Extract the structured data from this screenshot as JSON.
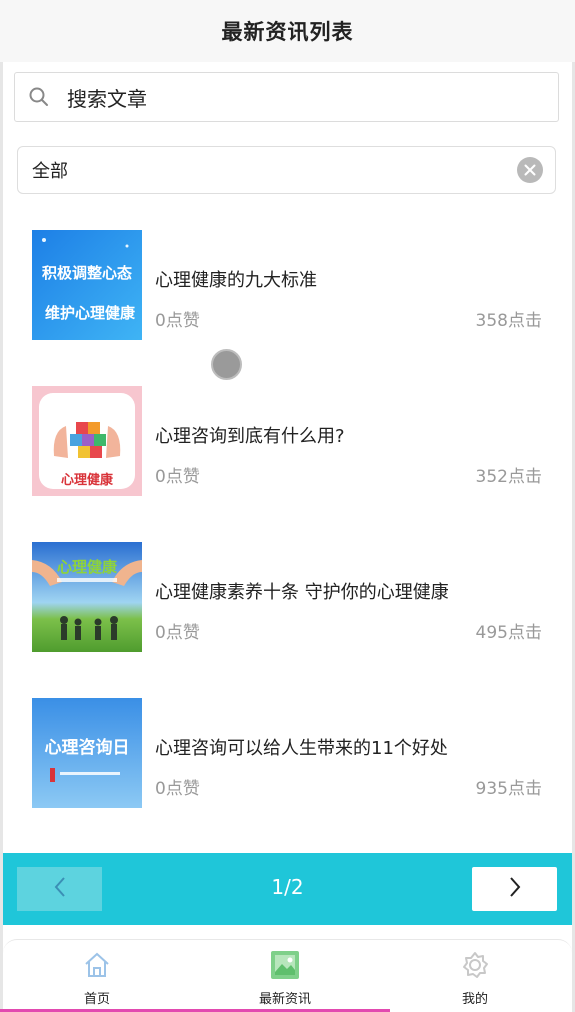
{
  "header": {
    "title": "最新资讯列表"
  },
  "search": {
    "placeholder": "搜索文章",
    "icon": "search-icon"
  },
  "filter": {
    "value": "全部",
    "clear_icon": "clear-circle-icon"
  },
  "articles": [
    {
      "title": "心理健康的九大标准",
      "likes": "0点赞",
      "clicks": "358点击",
      "thumb_text": [
        "积极调整心态",
        "维护心理健康"
      ]
    },
    {
      "title": "心理咨询到底有什么用?",
      "likes": "0点赞",
      "clicks": "352点击",
      "thumb_text": [
        "心理健康"
      ]
    },
    {
      "title": "心理健康素养十条 守护你的心理健康",
      "likes": "0点赞",
      "clicks": "495点击",
      "thumb_text": [
        "心理健康"
      ]
    },
    {
      "title": "心理咨询可以给人生带来的11个好处",
      "likes": "0点赞",
      "clicks": "935点击",
      "thumb_text": [
        "心理咨询日"
      ]
    }
  ],
  "pager": {
    "page": "1/2",
    "prev_icon": "chevron-left-icon",
    "next_icon": "chevron-right-icon"
  },
  "tabbar": {
    "items": [
      {
        "label": "首页",
        "icon": "home-icon"
      },
      {
        "label": "最新资讯",
        "icon": "image-icon"
      },
      {
        "label": "我的",
        "icon": "gear-icon"
      }
    ]
  },
  "colors": {
    "accent": "#1fc6d9",
    "prev_button": "#5dd3df",
    "muted_text": "#999999"
  }
}
